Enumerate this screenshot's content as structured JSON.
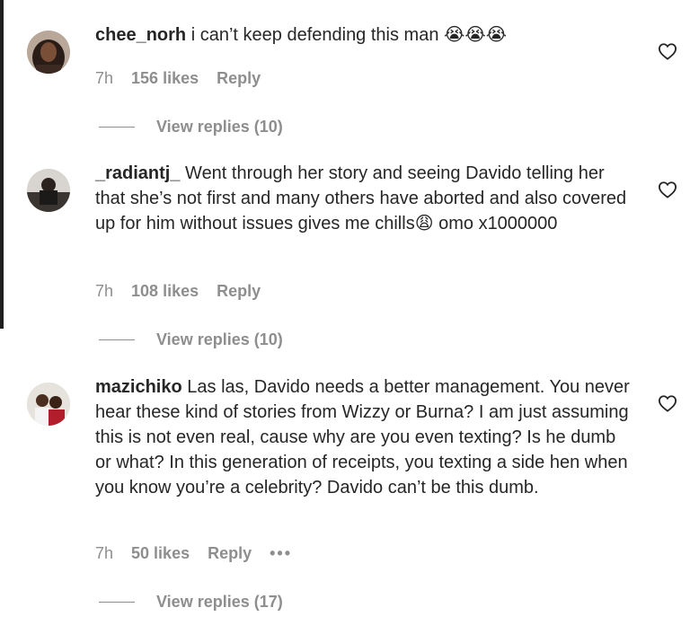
{
  "comments": [
    {
      "username": "chee_norh",
      "text": "i can’t keep defending this man 😭😭😭",
      "time": "7h",
      "likes": "156 likes",
      "reply": "Reply",
      "view_replies": "View replies (10)"
    },
    {
      "username": "_radiantj_",
      "text": "Went through her story and seeing Davido telling her that she’s not first and many others have aborted and also covered up for him without issues gives me chills😩 omo x1000000",
      "time": "7h",
      "likes": "108 likes",
      "reply": "Reply",
      "view_replies": "View replies (10)"
    },
    {
      "username": "mazichiko",
      "text": "Las las, Davido needs a better management. You never hear these kind of stories from Wizzy or Burna? I am just assuming this is not even real, cause why are you even texting? Is he dumb or what? In this generation of receipts, you texting a side hen when you know you’re a celebrity? Davido can’t be this dumb.",
      "time": "7h",
      "likes": "50 likes",
      "reply": "Reply",
      "more": "•••",
      "view_replies": "View replies (17)"
    }
  ],
  "colors": {
    "text": "#262626",
    "muted": "#8e8e8e",
    "background": "#ffffff"
  },
  "icons": {
    "like": "heart-outline-icon",
    "more": "more-options-icon"
  }
}
